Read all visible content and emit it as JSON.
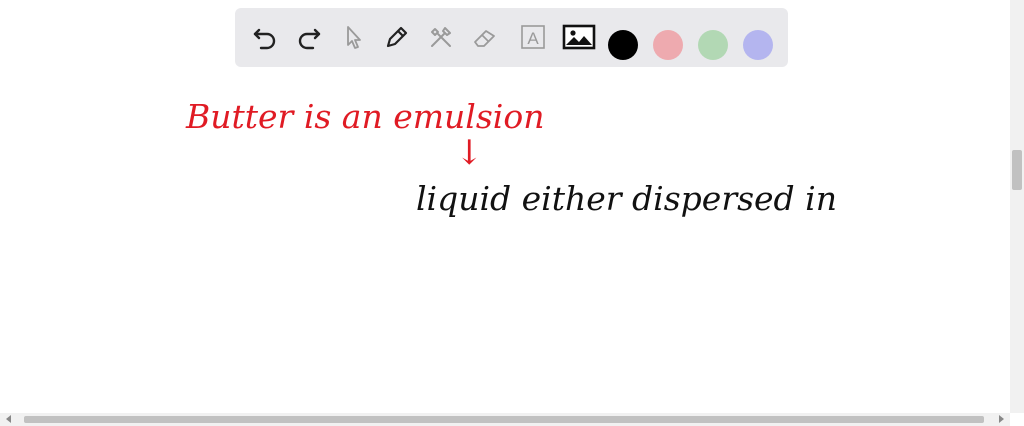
{
  "toolbar": {
    "tools": [
      {
        "name": "undo-icon"
      },
      {
        "name": "redo-icon"
      },
      {
        "name": "pointer-icon"
      },
      {
        "name": "pen-icon"
      },
      {
        "name": "tools-icon"
      },
      {
        "name": "eraser-icon"
      },
      {
        "name": "text-icon",
        "glyph": "A"
      },
      {
        "name": "image-icon"
      }
    ],
    "colors": [
      {
        "name": "black",
        "hex": "#000000",
        "selected": true
      },
      {
        "name": "red",
        "hex": "#eeaaaf",
        "selected": false
      },
      {
        "name": "green",
        "hex": "#b2d8b4",
        "selected": false
      },
      {
        "name": "blue",
        "hex": "#b4b5ef",
        "selected": false
      }
    ]
  },
  "canvas": {
    "handwriting": [
      {
        "text": "Butter is an emulsion",
        "color": "#e01b24"
      },
      {
        "text": "↓",
        "color": "#e01b24"
      },
      {
        "text": "liquid either dispersed in",
        "color": "#111111"
      }
    ]
  }
}
